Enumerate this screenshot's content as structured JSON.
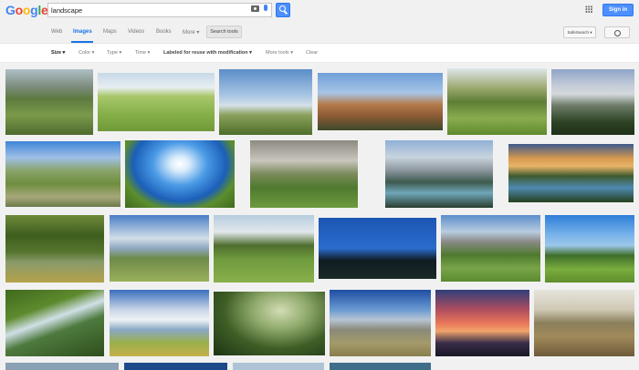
{
  "search": {
    "query": "landscape"
  },
  "header": {
    "sign_in": "Sign in"
  },
  "tabs": {
    "web": "Web",
    "images": "Images",
    "maps": "Maps",
    "videos": "Videos",
    "books": "Books",
    "more": "More ▾",
    "search_tools": "Search tools"
  },
  "settings": {
    "safesearch": "SafeSearch ▾"
  },
  "tools": {
    "size": "Size ▾",
    "color": "Color ▾",
    "type": "Type ▾",
    "time": "Time ▾",
    "license": "Labeled for reuse with modification ▾",
    "more_tools": "More tools ▾",
    "clear": "Clear"
  },
  "results": [
    {
      "scene": "valley"
    },
    {
      "scene": "meadow"
    },
    {
      "scene": "plains"
    },
    {
      "scene": "arch"
    },
    {
      "scene": "forest-field"
    },
    {
      "scene": "mountain-forest"
    },
    {
      "scene": "hiker"
    },
    {
      "scene": "fisheye"
    },
    {
      "scene": "hills"
    },
    {
      "scene": "mountain-lake"
    },
    {
      "scene": "sunset-lake"
    },
    {
      "scene": "bridge"
    },
    {
      "scene": "clouds-hills"
    },
    {
      "scene": "trees-field"
    },
    {
      "scene": "night-treeline"
    },
    {
      "scene": "alpine-village"
    },
    {
      "scene": "green-trees"
    },
    {
      "scene": "waterfall"
    },
    {
      "scene": "sky-field"
    },
    {
      "scene": "grass-closeup"
    },
    {
      "scene": "mountains-plain"
    },
    {
      "scene": "pink-sunset"
    },
    {
      "scene": "wheat-field"
    },
    {
      "scene": "partial-1"
    },
    {
      "scene": "partial-2"
    },
    {
      "scene": "partial-3"
    },
    {
      "scene": "partial-4"
    }
  ]
}
